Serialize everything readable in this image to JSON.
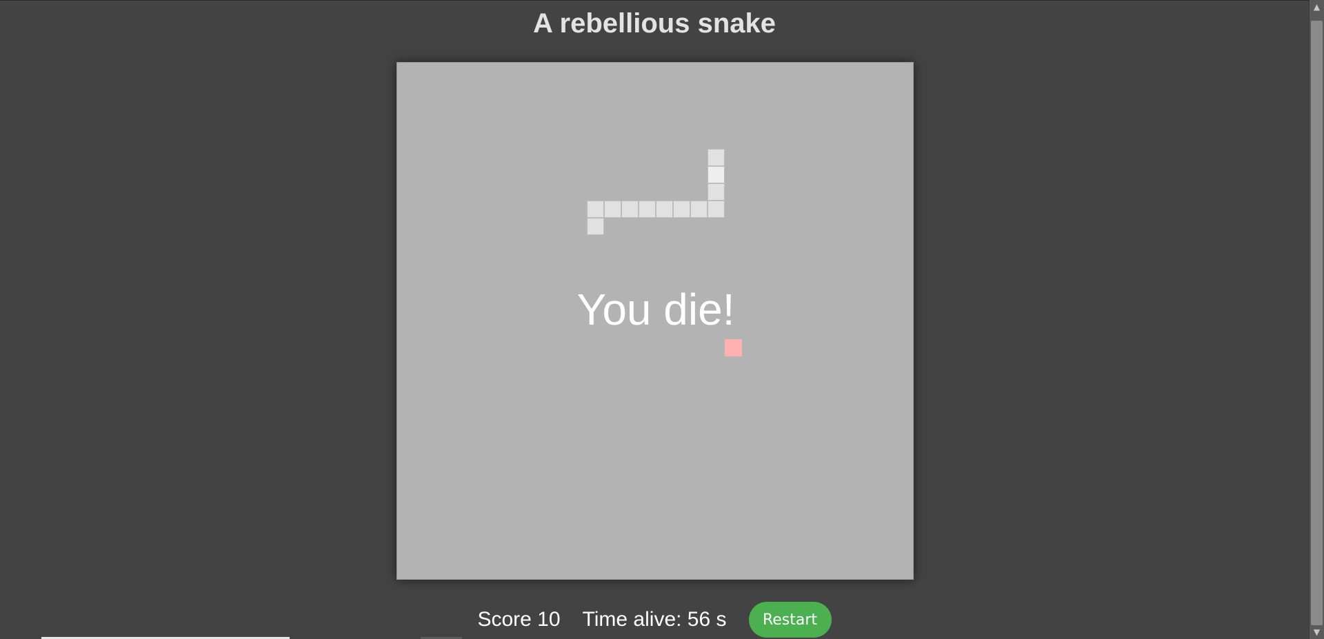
{
  "page": {
    "title": "A rebellious snake"
  },
  "game": {
    "message": "You die!",
    "grid_columns": 30,
    "grid_rows": 30,
    "snake_cells": [
      [
        18,
        5
      ],
      [
        18,
        6
      ],
      [
        18,
        7
      ],
      [
        18,
        8
      ],
      [
        17,
        8
      ],
      [
        16,
        8
      ],
      [
        15,
        8
      ],
      [
        14,
        8
      ],
      [
        13,
        8
      ],
      [
        12,
        8
      ],
      [
        11,
        8
      ],
      [
        11,
        9
      ]
    ],
    "food_cell": [
      19,
      16
    ],
    "colors": {
      "board": "#b3b3b3",
      "snake": "#e1e1e1",
      "food": "#ffb1b1",
      "background": "#434343"
    }
  },
  "footer": {
    "score_text": "Score 10",
    "time_text": "Time alive: 56 s",
    "restart_label": "Restart",
    "restart_color": "#4caf50"
  },
  "scrollbar": {
    "up_icon": "▲",
    "down_icon": "▼"
  }
}
